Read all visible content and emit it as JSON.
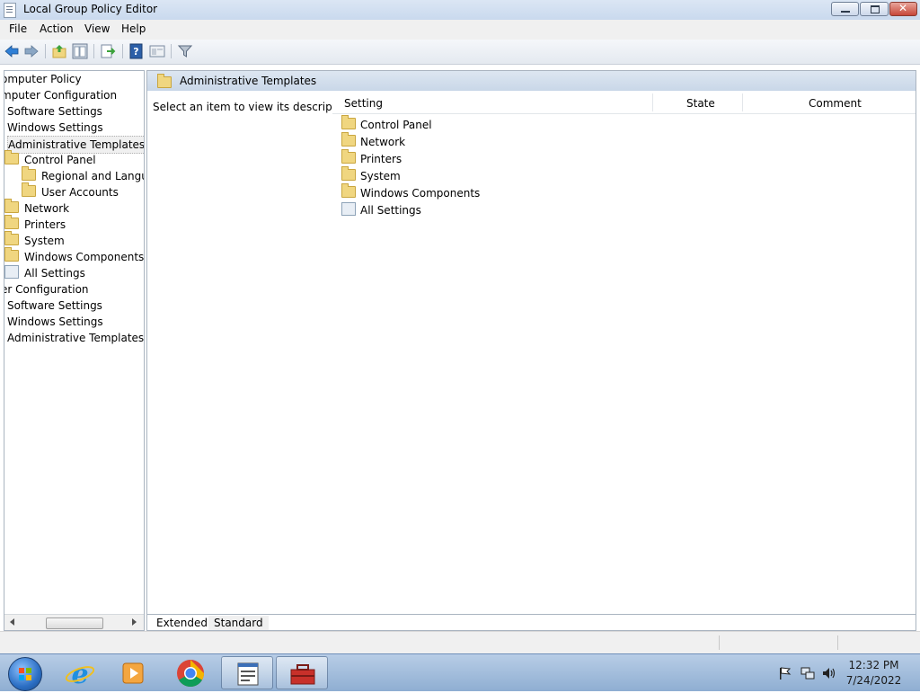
{
  "window": {
    "title": "Local Group Policy Editor"
  },
  "menu": [
    "File",
    "Action",
    "View",
    "Help"
  ],
  "toolbar_icons": [
    "back-arrow-icon",
    "forward-arrow-icon",
    "up-folder-icon",
    "show-hide-tree-icon",
    "export-list-icon",
    "help-icon",
    "properties-icon",
    "filter-icon"
  ],
  "tree": {
    "items": [
      {
        "label": "Computer Policy",
        "indent": 0,
        "icon": "none",
        "visible_label": "omputer Policy"
      },
      {
        "label": "Computer Configuration",
        "indent": 0,
        "icon": "none",
        "visible_label": "mputer Configuration"
      },
      {
        "label": "Software Settings",
        "indent": 1,
        "icon": "none"
      },
      {
        "label": "Windows Settings",
        "indent": 1,
        "icon": "none"
      },
      {
        "label": "Administrative Templates",
        "indent": 1,
        "icon": "none",
        "selected": true
      },
      {
        "label": "Control Panel",
        "indent": 2,
        "icon": "folder"
      },
      {
        "label": "Regional and Langua",
        "indent": 3,
        "icon": "folder"
      },
      {
        "label": "User Accounts",
        "indent": 3,
        "icon": "folder"
      },
      {
        "label": "Network",
        "indent": 2,
        "icon": "folder"
      },
      {
        "label": "Printers",
        "indent": 2,
        "icon": "folder"
      },
      {
        "label": "System",
        "indent": 2,
        "icon": "folder"
      },
      {
        "label": "Windows Components",
        "indent": 2,
        "icon": "folder"
      },
      {
        "label": "All Settings",
        "indent": 2,
        "icon": "all-settings"
      },
      {
        "label": "er Configuration",
        "indent": 0,
        "icon": "none"
      },
      {
        "label": "Software Settings",
        "indent": 1,
        "icon": "none"
      },
      {
        "label": "Windows Settings",
        "indent": 1,
        "icon": "none"
      },
      {
        "label": "Administrative Templates",
        "indent": 1,
        "icon": "none"
      }
    ]
  },
  "content": {
    "header_title": "Administrative Templates",
    "description": "Select an item to view its description.",
    "columns": [
      "Setting",
      "State",
      "Comment"
    ],
    "items": [
      {
        "label": "Control Panel",
        "icon": "folder"
      },
      {
        "label": "Network",
        "icon": "folder"
      },
      {
        "label": "Printers",
        "icon": "folder"
      },
      {
        "label": "System",
        "icon": "folder"
      },
      {
        "label": "Windows Components",
        "icon": "folder"
      },
      {
        "label": "All Settings",
        "icon": "all-settings"
      }
    ],
    "tabs": [
      "Extended",
      "Standard"
    ]
  },
  "taskbar": {
    "apps": [
      "internet-explorer-icon",
      "media-player-icon",
      "chrome-icon",
      "notepad-window-icon",
      "toolbox-icon"
    ],
    "tray_icons": [
      "action-center-flag-icon",
      "network-icon",
      "volume-icon"
    ],
    "time": "12:32 PM",
    "date": "7/24/2022"
  },
  "colors": {
    "header_gradient": "#c9d7e8",
    "taskbar": "#8faed2",
    "folder": "#f0d680"
  }
}
